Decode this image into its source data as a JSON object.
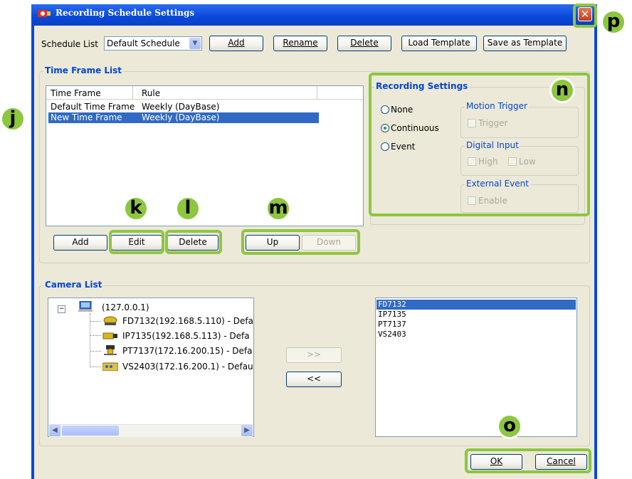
{
  "window": {
    "title": "Recording Schedule Settings",
    "close_symbol": "✕"
  },
  "schedule": {
    "label": "Schedule List",
    "selected": "Default Schedule",
    "buttons": {
      "add": "Add",
      "rename": "Rename",
      "delete": "Delete",
      "load_template": "Load Template",
      "save_template": "Save as Template"
    }
  },
  "time_frame": {
    "legend": "Time Frame List",
    "columns": [
      "Time Frame",
      "Rule"
    ],
    "rows": [
      {
        "name": "Default Time Frame",
        "rule": "Weekly (DayBase)"
      },
      {
        "name": "New Time Frame",
        "rule": "Weekly (DayBase)"
      }
    ],
    "buttons": {
      "add": "Add",
      "edit": "Edit",
      "delete": "Delete",
      "up": "Up",
      "down": "Down"
    }
  },
  "recording": {
    "legend": "Recording Settings",
    "modes": [
      "None",
      "Continuous",
      "Event"
    ],
    "selected_mode": "Continuous",
    "motion": {
      "legend": "Motion Trigger",
      "trigger": "Trigger"
    },
    "digital": {
      "legend": "Digital Input",
      "high": "High",
      "low": "Low"
    },
    "external": {
      "legend": "External Event",
      "enable": "Enable"
    }
  },
  "camera": {
    "legend": "Camera List",
    "root": "(127.0.0.1)",
    "tree": [
      "FD7132(192.168.5.110) - Defa",
      "IP7135(192.168.5.113) - Defa",
      "PT7137(172.16.200.15) - Defa",
      "VS2403(172.16.200.1) - Defau"
    ],
    "add_button": ">>",
    "remove_button": "<<",
    "selected_list": [
      "FD7132",
      "IP7135",
      "PT7137",
      "VS2403"
    ],
    "expand_symbol": "−"
  },
  "dialog": {
    "ok": "OK",
    "cancel": "Cancel"
  },
  "callouts": {
    "j": "j",
    "k": "k",
    "l": "l",
    "m": "m",
    "n": "n",
    "o": "o",
    "p": "p"
  },
  "colors": {
    "accent_callout": "#8dc63f",
    "title_blue": "#0a48d8",
    "legend_blue": "#0046d5",
    "selection": "#316ac5"
  }
}
